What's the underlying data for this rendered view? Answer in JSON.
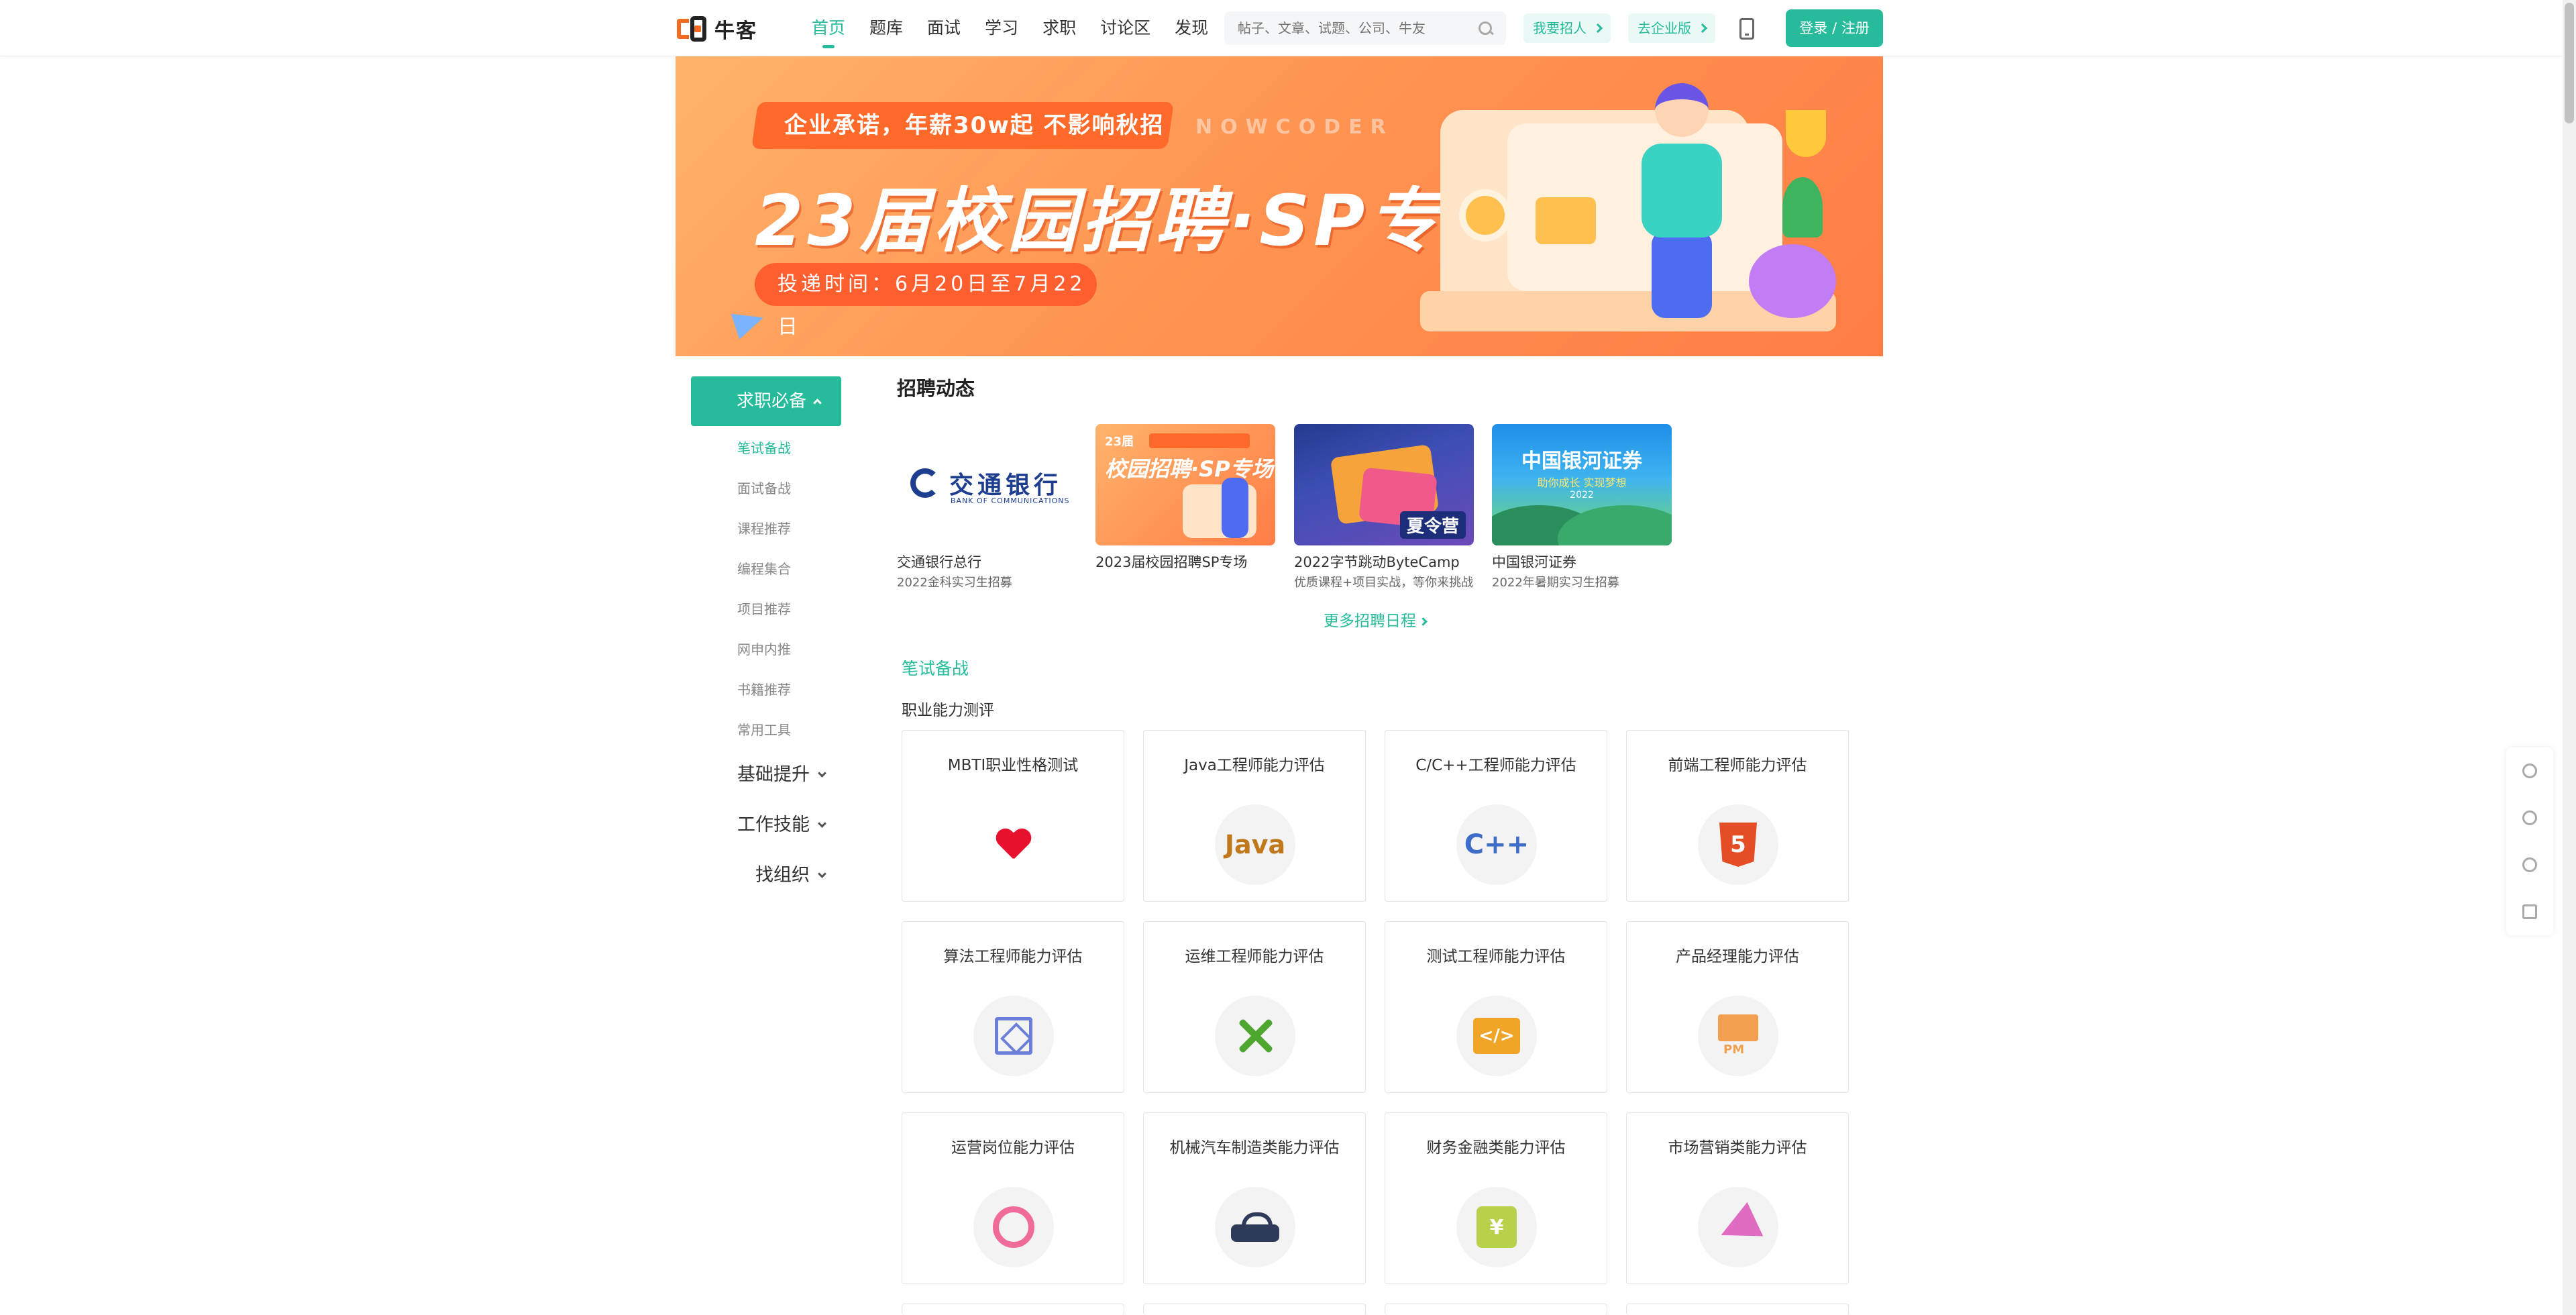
{
  "header": {
    "logo_text": "牛客",
    "nav": [
      "首页",
      "题库",
      "面试",
      "学习",
      "求职",
      "讨论区",
      "发现"
    ],
    "active_nav": "首页",
    "search_placeholder": "帖子、文章、试题、公司、牛友",
    "hire_label": "我要招人",
    "enterprise_label": "去企业版",
    "login_label": "登录 / 注册"
  },
  "banner": {
    "ribbon_text": "企业承诺，年薪30w起 不影响秋招",
    "brand_text": "NOWCODER",
    "title": "23届校园招聘·SP专场",
    "date_text": "投递时间：6月20日至7月22日"
  },
  "sidebar": {
    "main_label": "求职必备",
    "sub_items": [
      "笔试备战",
      "面试备战",
      "课程推荐",
      "编程集合",
      "项目推荐",
      "网申内推",
      "书籍推荐",
      "常用工具"
    ],
    "active_sub": "笔试备战",
    "groups": [
      "基础提升",
      "工作技能",
      "找组织"
    ]
  },
  "recruit": {
    "heading": "招聘动态",
    "cards": [
      {
        "name": "交通银行总行",
        "sub": "2022金科实习生招募",
        "logo_cn": "交通银行",
        "logo_en": "BANK OF COMMUNICATIONS"
      },
      {
        "name": "2023届校园招聘SP专场",
        "sub": "",
        "thumb_title": "校园招聘·SP专场",
        "thumb_tag": "23届"
      },
      {
        "name": "2022字节跳动ByteCamp",
        "sub": "优质课程+项目实战，等你来挑战",
        "thumb_tag": "夏令营"
      },
      {
        "name": "中国银河证券",
        "sub": "2022年暑期实习生招募",
        "thumb_title": "中国银河证券",
        "thumb_line": "助你成长 实现梦想",
        "thumb_year": "2022"
      }
    ],
    "more_label": "更多招聘日程"
  },
  "written": {
    "heading": "笔试备战",
    "subheading": "职业能力测评",
    "tiles": [
      {
        "label": "MBTI职业性格测试",
        "icon": "heart-icon"
      },
      {
        "label": "Java工程师能力评估",
        "icon": "java-icon",
        "glyph": "Java"
      },
      {
        "label": "C/C++工程师能力评估",
        "icon": "cpp-icon",
        "glyph": "C++"
      },
      {
        "label": "前端工程师能力评估",
        "icon": "html5-icon",
        "glyph": "5"
      },
      {
        "label": "算法工程师能力评估",
        "icon": "algorithm-icon"
      },
      {
        "label": "运维工程师能力评估",
        "icon": "wrench-icon"
      },
      {
        "label": "测试工程师能力评估",
        "icon": "code-icon",
        "glyph": "</>"
      },
      {
        "label": "产品经理能力评估",
        "icon": "pm-icon",
        "glyph": "PM"
      },
      {
        "label": "运营岗位能力评估",
        "icon": "operation-icon"
      },
      {
        "label": "机械汽车制造类能力评估",
        "icon": "machinery-icon"
      },
      {
        "label": "财务金融类能力评估",
        "icon": "money-icon",
        "glyph": "¥"
      },
      {
        "label": "市场营销类能力评估",
        "icon": "megaphone-icon"
      }
    ]
  },
  "colors": {
    "accent": "#25bb9b",
    "banner": "#ff8f4f"
  }
}
